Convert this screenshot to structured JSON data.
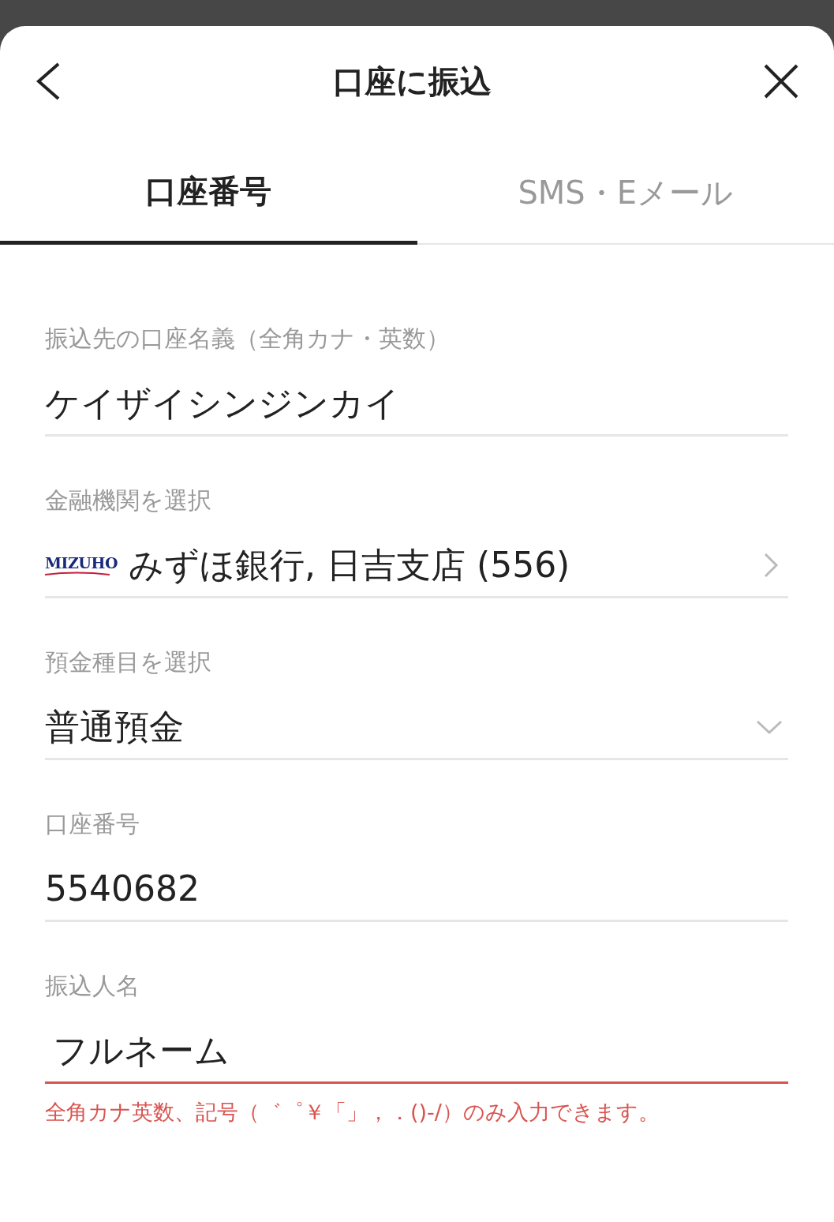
{
  "header": {
    "title": "口座に振込"
  },
  "tabs": [
    {
      "label": "口座番号",
      "selected": true
    },
    {
      "label": "SMS・Eメール",
      "selected": false
    }
  ],
  "fields": [
    {
      "kind": "text",
      "label": "振込先の口座名義（全角カナ・英数）",
      "value": "ケイザイシンジンカイ"
    },
    {
      "kind": "select",
      "label": "金融機関を選択",
      "logo_text": "MIZUHO",
      "value": "みずほ銀行, 日吉支店 (556)"
    },
    {
      "kind": "dropdown",
      "label": "預金種目を選択",
      "value": "普通預金"
    },
    {
      "kind": "text",
      "label": "口座番号",
      "value": "5540682"
    },
    {
      "kind": "input",
      "label": "振込人名",
      "value": "フルネーム",
      "error": "全角カナ英数、記号（゛゜￥「」，．()-/）のみ入力できます。"
    }
  ]
}
